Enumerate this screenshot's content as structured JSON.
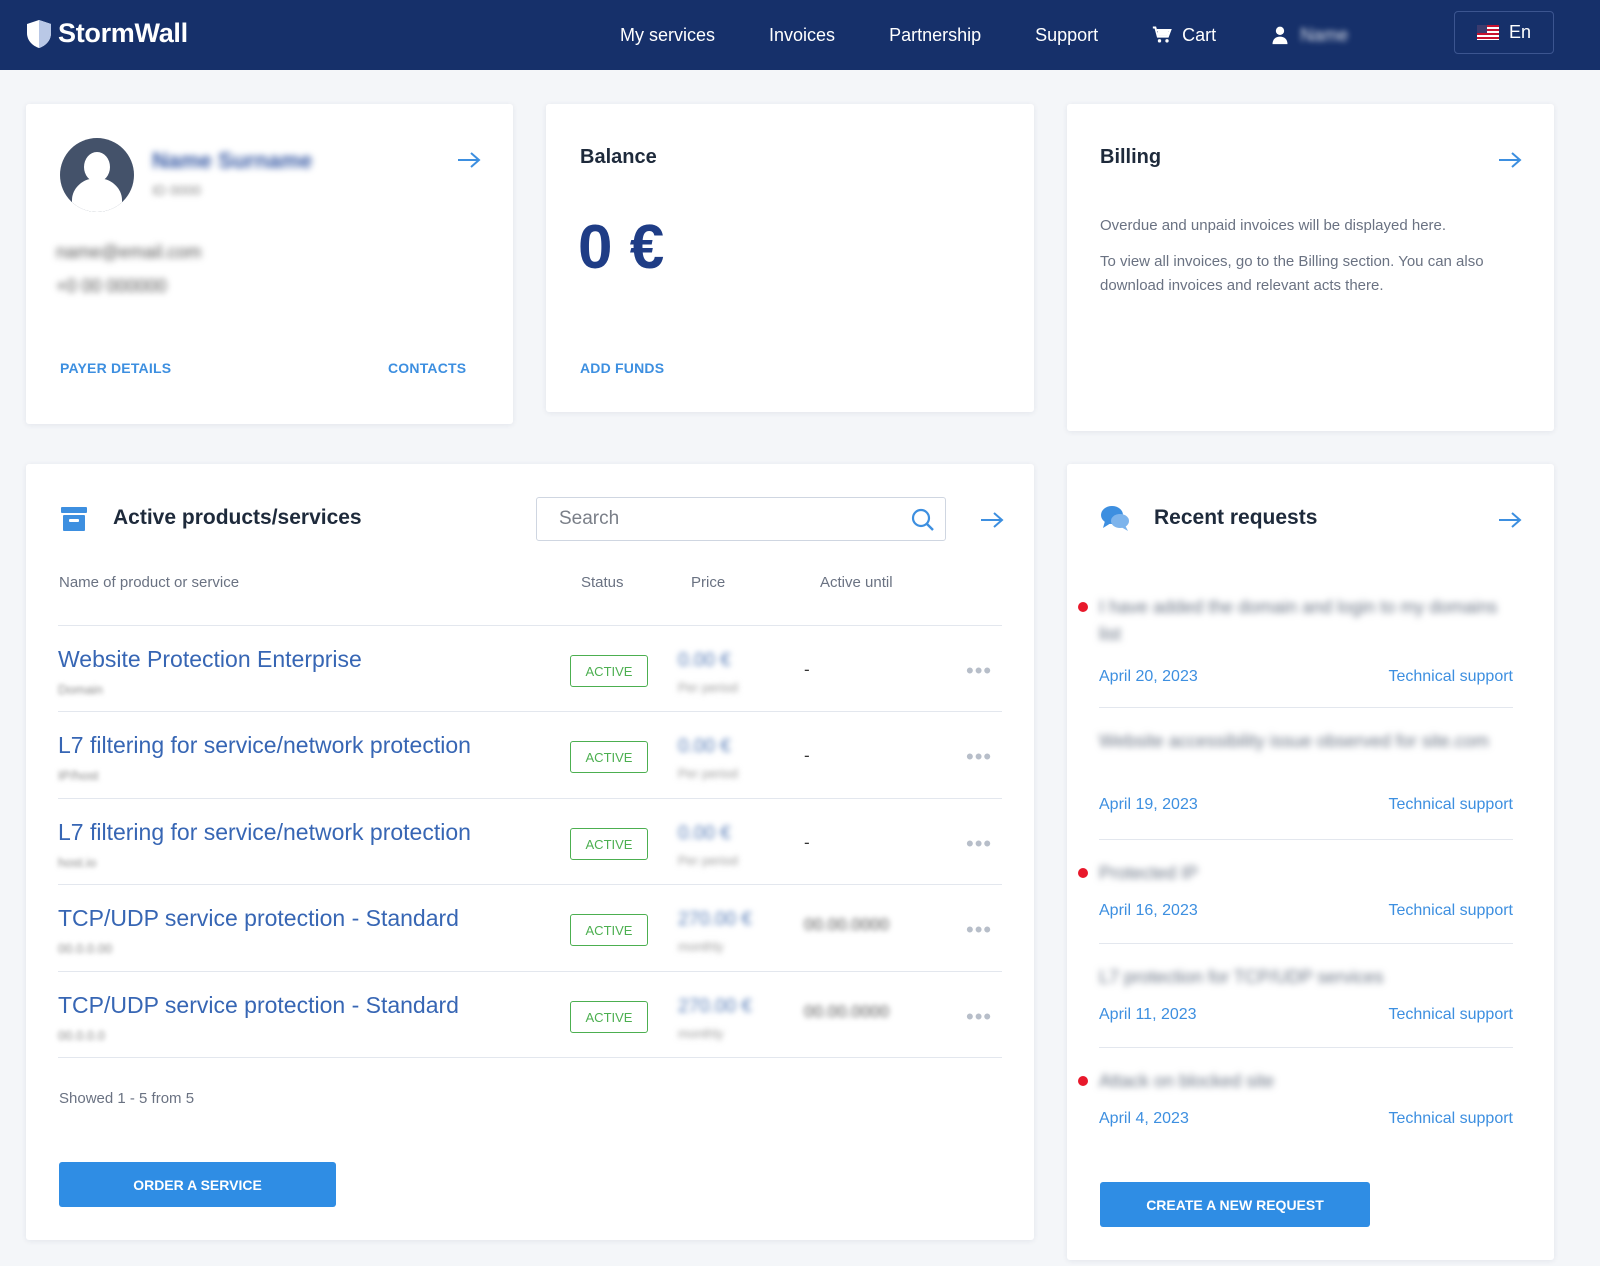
{
  "header": {
    "logo": "StormWall",
    "nav": [
      {
        "label": "My services"
      },
      {
        "label": "Invoices"
      },
      {
        "label": "Partnership"
      },
      {
        "label": "Support"
      }
    ],
    "cart": "Cart",
    "user": "Name",
    "lang": "En"
  },
  "profile": {
    "name": "Name Surname",
    "id": "ID 0000",
    "email": "name@email.com",
    "phone": "+0 00 000000",
    "payer_details": "PAYER DETAILS",
    "contacts": "CONTACTS"
  },
  "balance": {
    "title": "Balance",
    "amount": "0 €",
    "add_funds": "ADD FUNDS"
  },
  "billing": {
    "title": "Billing",
    "text1": "Overdue and unpaid invoices will be displayed here.",
    "text2": "To view all invoices, go to the Billing section. You can also download invoices and relevant acts there."
  },
  "services": {
    "title": "Active products/services",
    "search_placeholder": "Search",
    "columns": {
      "name": "Name of product or service",
      "status": "Status",
      "price": "Price",
      "until": "Active until"
    },
    "rows": [
      {
        "name": "Website Protection Enterprise",
        "sub": "Domain",
        "status": "ACTIVE",
        "price": "0.00 €",
        "price_sub": "Per period",
        "until": "-"
      },
      {
        "name": "L7 filtering for service/network protection",
        "sub": "IP/host",
        "status": "ACTIVE",
        "price": "0.00 €",
        "price_sub": "Per period",
        "until": "-"
      },
      {
        "name": "L7 filtering for service/network protection",
        "sub": "host.io",
        "status": "ACTIVE",
        "price": "0.00 €",
        "price_sub": "Per period",
        "until": "-"
      },
      {
        "name": "TCP/UDP service protection - Standard",
        "sub": "00.0.0.00",
        "status": "ACTIVE",
        "price": "270.00 €",
        "price_sub": "monthly",
        "until": "00.00.0000"
      },
      {
        "name": "TCP/UDP service protection - Standard",
        "sub": "00.0.0.0",
        "status": "ACTIVE",
        "price": "270.00 €",
        "price_sub": "monthly",
        "until": "00.00.0000"
      }
    ],
    "footer": "Showed 1 - 5 from 5",
    "order_btn": "ORDER A SERVICE",
    "dots": "•••"
  },
  "requests": {
    "title": "Recent requests",
    "items": [
      {
        "text": "I have added the domain and login to my domains list",
        "date": "April 20, 2023",
        "category": "Technical support",
        "unread": true
      },
      {
        "text": "Website accessibility issue observed for site.com",
        "date": "April 19, 2023",
        "category": "Technical support",
        "unread": false
      },
      {
        "text": "Protected IP",
        "date": "April 16, 2023",
        "category": "Technical support",
        "unread": true
      },
      {
        "text": "L7 protection for TCP/UDP services",
        "date": "April 11, 2023",
        "category": "Technical support",
        "unread": false
      },
      {
        "text": "Attack on blocked site",
        "date": "April 4, 2023",
        "category": "Technical support",
        "unread": true
      }
    ],
    "create_btn": "CREATE A NEW REQUEST"
  }
}
